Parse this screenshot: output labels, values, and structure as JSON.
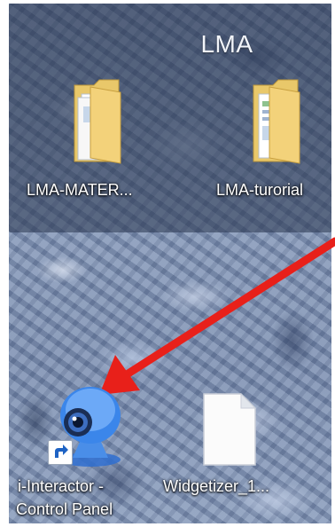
{
  "group": {
    "title": "LMA"
  },
  "desktop_icons": [
    {
      "label": "LMA-MATER...",
      "icon": "folder-icon"
    },
    {
      "label": "LMA-turorial",
      "icon": "folder-icon"
    },
    {
      "label_line1": "i-Interactor -",
      "label_line2": "Control Panel",
      "icon": "webcam-icon",
      "shortcut": true
    },
    {
      "label": "Widgetizer_1...",
      "icon": "blank-document-icon"
    }
  ],
  "annotation": {
    "icon": "red-arrow-icon",
    "color": "#e8201a"
  },
  "colors": {
    "panel": "#28344e",
    "arrow": "#e8201a",
    "label_text": "#ffffff"
  }
}
